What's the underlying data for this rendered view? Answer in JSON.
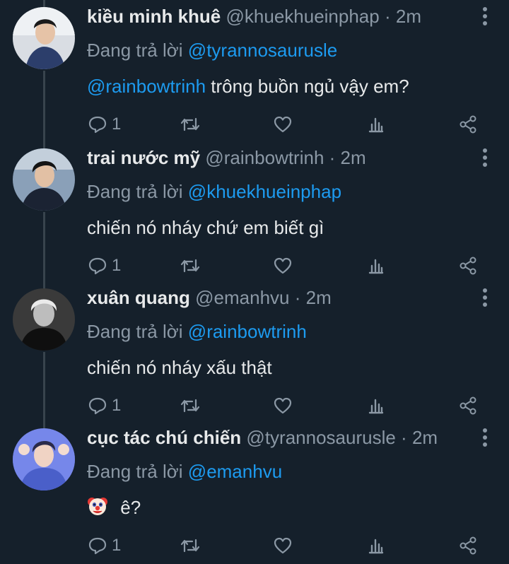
{
  "colors": {
    "background": "#15202b",
    "text": "#e7e9ea",
    "muted": "#8b98a5",
    "accent": "#1d9bf0",
    "thread_line": "#38444d"
  },
  "replying_label": "Đang trả lời",
  "tweets": [
    {
      "name": "kiều minh khuê",
      "handle": "@khuekhueinphap",
      "separator": "·",
      "time": "2m",
      "replying_to": "@tyrannosaurusle",
      "content_mention": "@rainbowtrinh",
      "content_text": "trông buồn ngủ vậy em?",
      "reply_count": "1",
      "avatar_icon": "profile-photo"
    },
    {
      "name": "trai nước mỹ",
      "handle": "@rainbowtrinh",
      "separator": "·",
      "time": "2m",
      "replying_to": "@khuekhueinphap",
      "content_mention": "",
      "content_text": "chiến nó nháy chứ em biết gì",
      "reply_count": "1",
      "avatar_icon": "profile-photo"
    },
    {
      "name": "xuân quang",
      "handle": "@emanhvu",
      "separator": "·",
      "time": "2m",
      "replying_to": "@rainbowtrinh",
      "content_mention": "",
      "content_text": "chiến nó nháy xấu thật",
      "reply_count": "1",
      "avatar_icon": "profile-photo"
    },
    {
      "name": "cục tác chú chiến",
      "handle": "@tyrannosaurusle",
      "separator": "·",
      "time": "2m",
      "replying_to": "@emanhvu",
      "content_mention": "",
      "content_emoji": "clown-face",
      "content_text": "ê?",
      "reply_count": "1",
      "avatar_icon": "profile-photo"
    }
  ]
}
